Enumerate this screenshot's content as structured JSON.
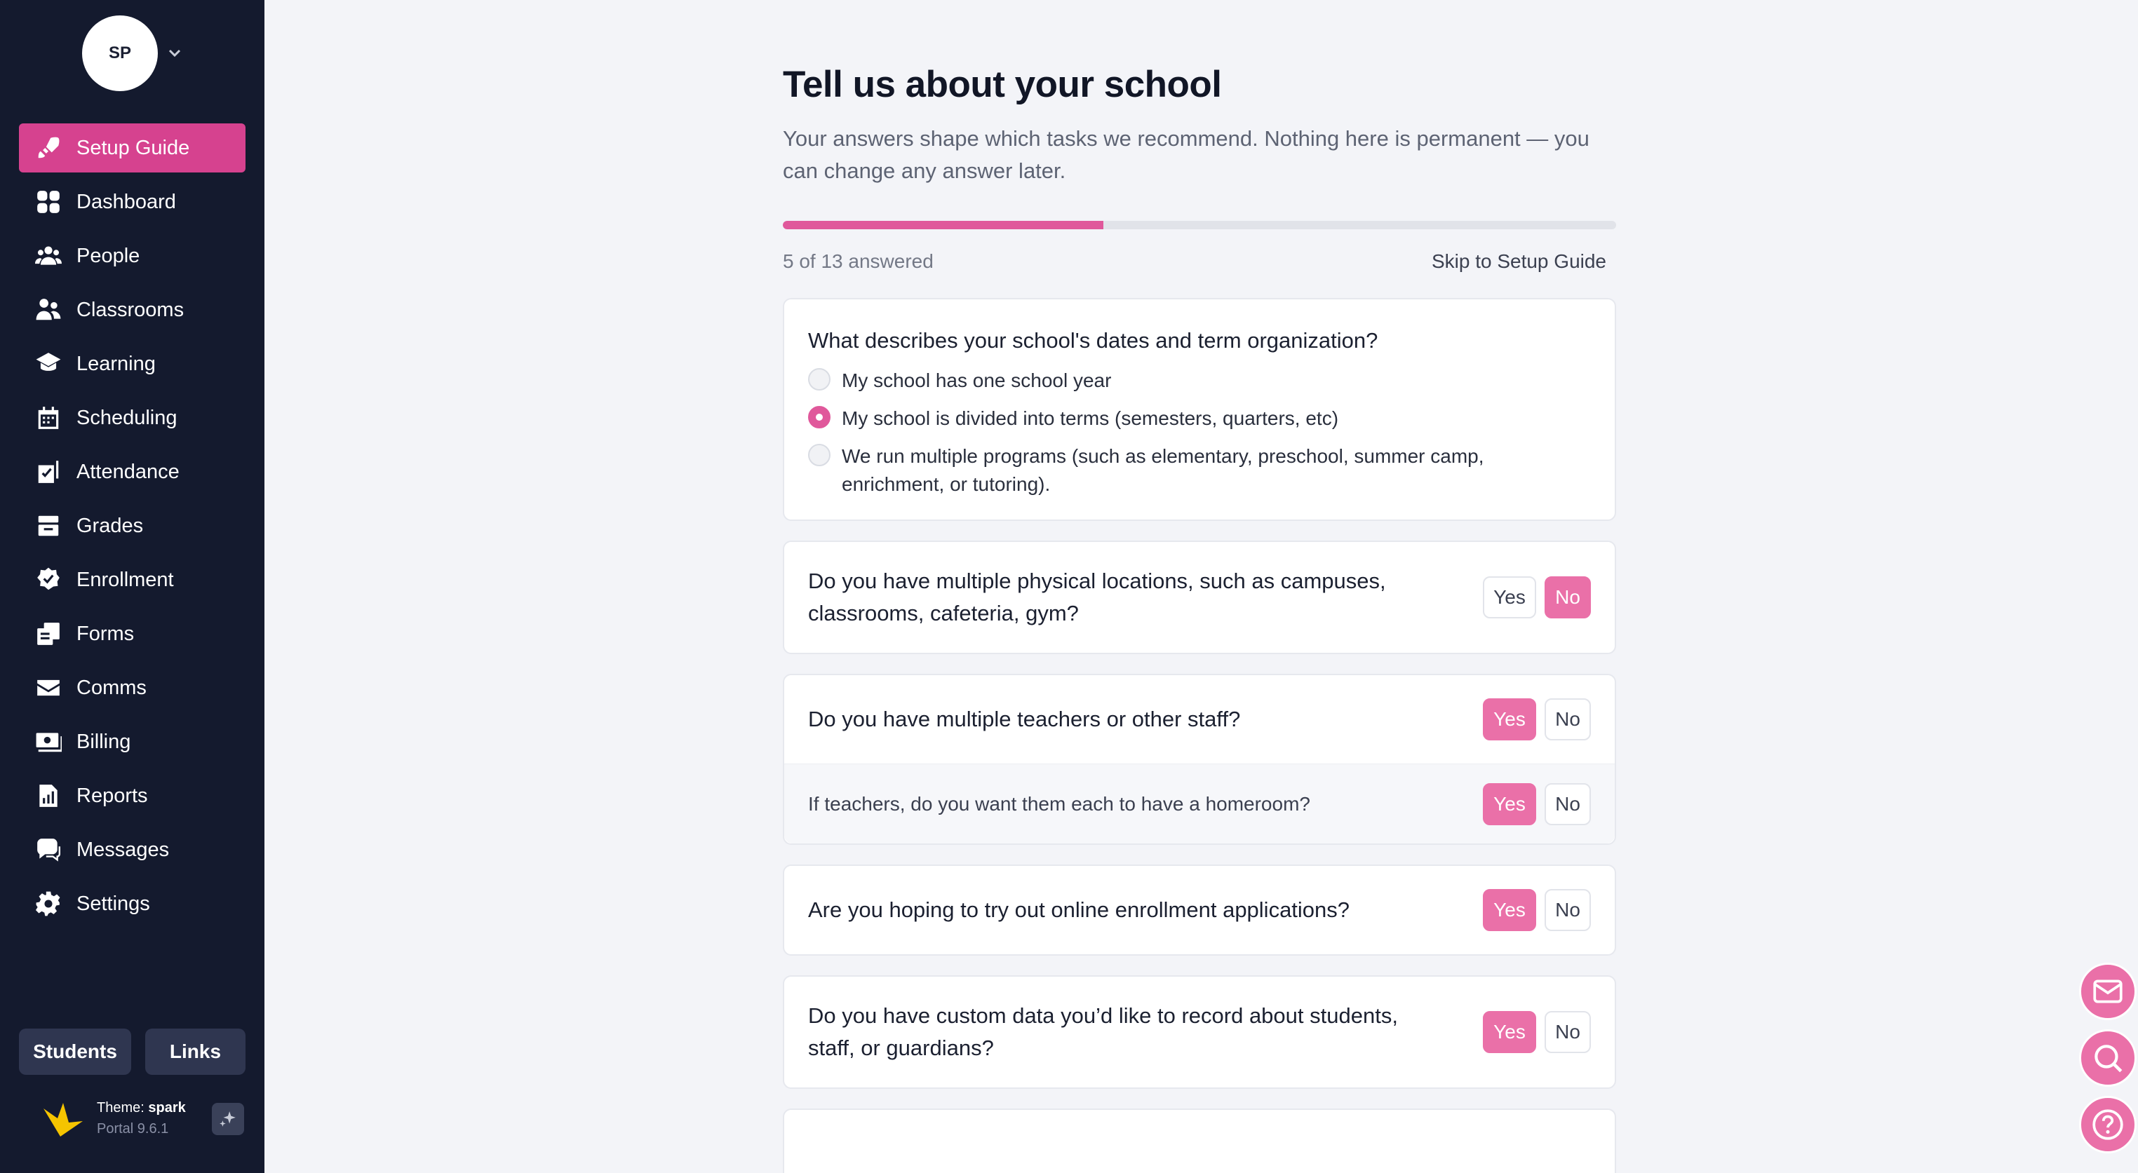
{
  "user": {
    "initials": "SP"
  },
  "nav": [
    {
      "label": "Setup Guide",
      "icon": "rocket-icon",
      "active": true
    },
    {
      "label": "Dashboard",
      "icon": "grid-icon"
    },
    {
      "label": "People",
      "icon": "people-icon"
    },
    {
      "label": "Classrooms",
      "icon": "classroom-icon"
    },
    {
      "label": "Learning",
      "icon": "graduation-cap-icon"
    },
    {
      "label": "Scheduling",
      "icon": "calendar-icon"
    },
    {
      "label": "Attendance",
      "icon": "checklist-icon"
    },
    {
      "label": "Grades",
      "icon": "tray-icon"
    },
    {
      "label": "Enrollment",
      "icon": "badge-check-icon"
    },
    {
      "label": "Forms",
      "icon": "forms-icon"
    },
    {
      "label": "Comms",
      "icon": "envelope-icon"
    },
    {
      "label": "Billing",
      "icon": "money-icon"
    },
    {
      "label": "Reports",
      "icon": "chart-file-icon"
    },
    {
      "label": "Messages",
      "icon": "chat-icon"
    },
    {
      "label": "Settings",
      "icon": "gear-icon"
    }
  ],
  "footer": {
    "students_label": "Students",
    "links_label": "Links",
    "theme_prefix": "Theme: ",
    "theme_name": "spark",
    "portal_version": "Portal 9.6.1"
  },
  "page": {
    "title": "Tell us about your school",
    "subtitle": "Your answers shape which tasks we recommend. Nothing here is permanent — you can change any answer later.",
    "progress": {
      "answered": 5,
      "total": 13,
      "fraction": 0.3846,
      "label": "5 of 13 answered"
    },
    "skip_label": "Skip to Setup Guide"
  },
  "questions": {
    "dates": {
      "title": "What describes your school's dates and term organization?",
      "options": [
        {
          "label": "My school has one school year",
          "selected": false
        },
        {
          "label": "My school is divided into terms (semesters, quarters, etc)",
          "selected": true
        },
        {
          "label": "We run multiple programs (such as elementary, preschool, summer camp, enrichment, or tutoring).",
          "selected": false
        }
      ]
    },
    "locations": {
      "title": "Do you have multiple physical locations, such as campuses, classrooms, cafeteria, gym?",
      "answer": "No"
    },
    "staff": {
      "title": "Do you have multiple teachers or other staff?",
      "answer": "Yes",
      "followup": {
        "title": "If teachers, do you want them each to have a homeroom?",
        "answer": "Yes"
      }
    },
    "enrollment": {
      "title": "Are you hoping to try out online enrollment applications?",
      "answer": "Yes"
    },
    "custom_data": {
      "title": "Do you have custom data you’d like to record about students, staff, or guardians?",
      "answer": "Yes"
    }
  },
  "yes_label": "Yes",
  "no_label": "No",
  "floating": [
    {
      "name": "mail-icon"
    },
    {
      "name": "search-icon"
    },
    {
      "name": "help-icon"
    }
  ],
  "colors": {
    "accent": "#d6428f",
    "accent_light": "#ea70a8",
    "sidebar_bg": "#141a2e",
    "page_bg": "#f3f4f8"
  }
}
